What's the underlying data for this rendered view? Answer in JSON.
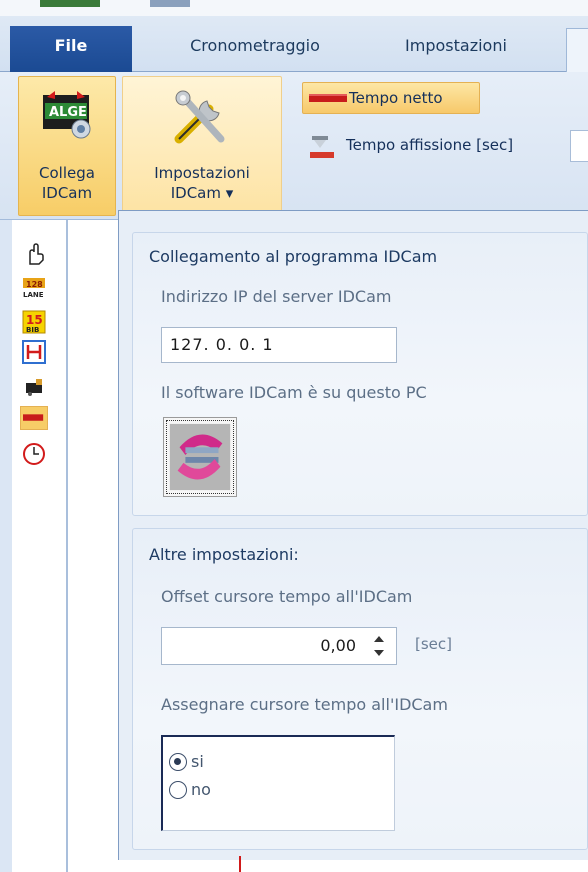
{
  "ribbon": {
    "tabs": [
      {
        "label": "File"
      },
      {
        "label": "Cronometraggio"
      },
      {
        "label": "Impostazioni"
      }
    ],
    "buttons": {
      "collega_line1": "Collega",
      "collega_line2": "IDCam",
      "impostazioni_line1": "Impostazioni",
      "impostazioni_line2": "IDCam ▾",
      "tempo_netto": "Tempo netto",
      "tempo_affissione": "Tempo affissione [sec]"
    },
    "logo_text": "ALGE"
  },
  "left_toolbar": {
    "icons": [
      "hand-cursor-icon",
      "lane-icon",
      "bib-icon",
      "measure-icon",
      "camera-icon",
      "red-bar-icon",
      "clock-icon"
    ],
    "lane_text": "128\nLANE",
    "bib_text": "15\nBIB"
  },
  "panel": {
    "group1": {
      "title": "Collegamento al programma IDCam",
      "ip_label": "Indirizzo IP del server IDCam",
      "ip_value": "127. 0. 0. 1",
      "local_label": "Il software IDCam è su questo PC"
    },
    "group2": {
      "title": "Altre impostazioni:",
      "offset_label": "Offset cursore tempo all'IDCam",
      "offset_value": "0,00",
      "offset_unit": "[sec]",
      "assign_label": "Assegnare cursore tempo all'IDCam",
      "options": [
        {
          "label": "si",
          "selected": true
        },
        {
          "label": "no",
          "selected": false
        }
      ]
    }
  },
  "colors": {
    "file_tab": "#1b4a93",
    "active_button": "#f7cd67",
    "tempo_netto_bar": "#c81b1b"
  }
}
